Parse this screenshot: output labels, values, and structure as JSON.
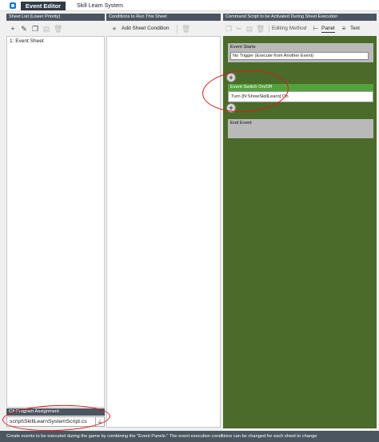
{
  "window": {
    "app_title": "Event Editor",
    "document_title": "Skill Learn System"
  },
  "sheet_list": {
    "header": "Sheet List (Lower Priority)",
    "items": [
      "1: Event Sheet"
    ]
  },
  "conditions": {
    "header": "Conditions to Run This Sheet",
    "add_label": "Add Sheet Condition"
  },
  "command_script": {
    "header": "Command Script to be Activated During Sheet Execution",
    "editing_method_label": "Editing Method",
    "panel_tab": "Panel",
    "text_tab": "Text",
    "event_starts": {
      "title": "Event Starts",
      "trigger": "No Trigger (Execute from Another Event)"
    },
    "switch_block": {
      "title": "Event Switch On/Off",
      "value": "Turn [N:ShowSkillLearn] On"
    },
    "event_end": {
      "title": "End Event"
    }
  },
  "csharp": {
    "header": "C# Program Assignment",
    "value": "script\\SkillLearnSystemScript.cs"
  },
  "status_bar": {
    "text": "Create events to be executed during the game by combining the \"Event Panels.\"  The event execution conditions can be changed for each sheet to change"
  },
  "colors": {
    "header_bg": "#4b5660",
    "canvas_bg": "#4b6b2a",
    "switch_header": "#52a33c",
    "annotation": "#e01818"
  }
}
